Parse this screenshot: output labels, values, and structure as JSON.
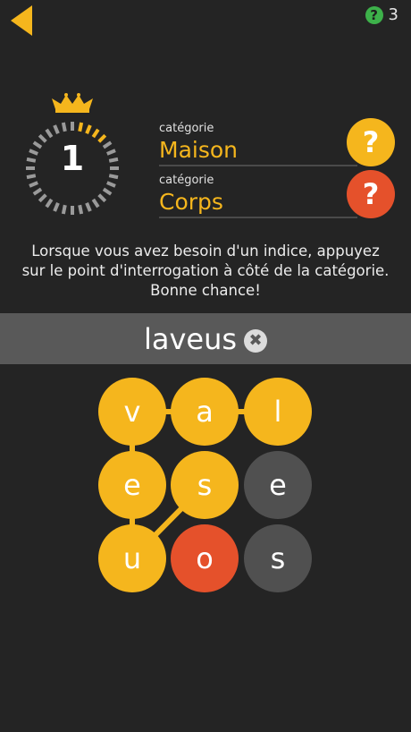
{
  "header": {
    "back_icon": "back-arrow-icon",
    "hint_icon_glyph": "?",
    "hint_count": "3"
  },
  "level": {
    "number": "1",
    "crown_icon": "crown-icon"
  },
  "categories": [
    {
      "label": "catégorie",
      "value": "Maison",
      "hint_glyph": "?",
      "hint_color": "#f5b61d"
    },
    {
      "label": "catégorie",
      "value": "Corps",
      "hint_glyph": "?",
      "hint_color": "#e5512b"
    }
  ],
  "instructions": "Lorsque vous avez besoin d'un indice, appuyez sur le point d'interrogation à côté de la catégorie. Bonne chance!",
  "answer": {
    "text": "laveus",
    "clear_glyph": "✖"
  },
  "grid": {
    "rows": [
      [
        {
          "letter": "v",
          "state": "selected"
        },
        {
          "letter": "a",
          "state": "selected"
        },
        {
          "letter": "l",
          "state": "selected"
        }
      ],
      [
        {
          "letter": "e",
          "state": "selected"
        },
        {
          "letter": "s",
          "state": "selected"
        },
        {
          "letter": "e",
          "state": "unselected"
        }
      ],
      [
        {
          "letter": "u",
          "state": "selected"
        },
        {
          "letter": "o",
          "state": "last"
        },
        {
          "letter": "s",
          "state": "unselected"
        }
      ]
    ]
  },
  "colors": {
    "accent": "#f5b61d",
    "highlight": "#e5512b",
    "inactive": "#505050",
    "background": "#242424"
  }
}
